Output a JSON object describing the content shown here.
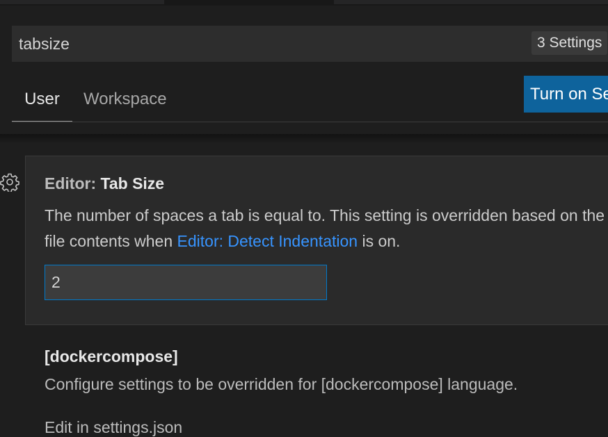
{
  "search": {
    "value": "tabsize",
    "result_count": "3 Settings"
  },
  "tabs": [
    {
      "label": "User",
      "active": true
    },
    {
      "label": "Workspace",
      "active": false
    }
  ],
  "sync_button": {
    "label": "Turn on Settings Sync"
  },
  "settings": [
    {
      "category": "Editor: ",
      "name": "Tab Size",
      "description_line1": "The number of spaces a tab is equal to. This setting is overridden based on the",
      "description_prefix": "file contents when ",
      "description_link": "Editor: Detect Indentation",
      "description_suffix": " is on.",
      "value": "2"
    },
    {
      "name": "[dockercompose]",
      "description": "Configure settings to be overridden for [dockercompose] language.",
      "action": "Edit in settings.json"
    }
  ],
  "colors": {
    "accent": "#007acc",
    "button": "#0e639c",
    "link": "#3794ff",
    "background": "#1e1e1e"
  },
  "icons": {
    "gear": "gear-icon"
  }
}
